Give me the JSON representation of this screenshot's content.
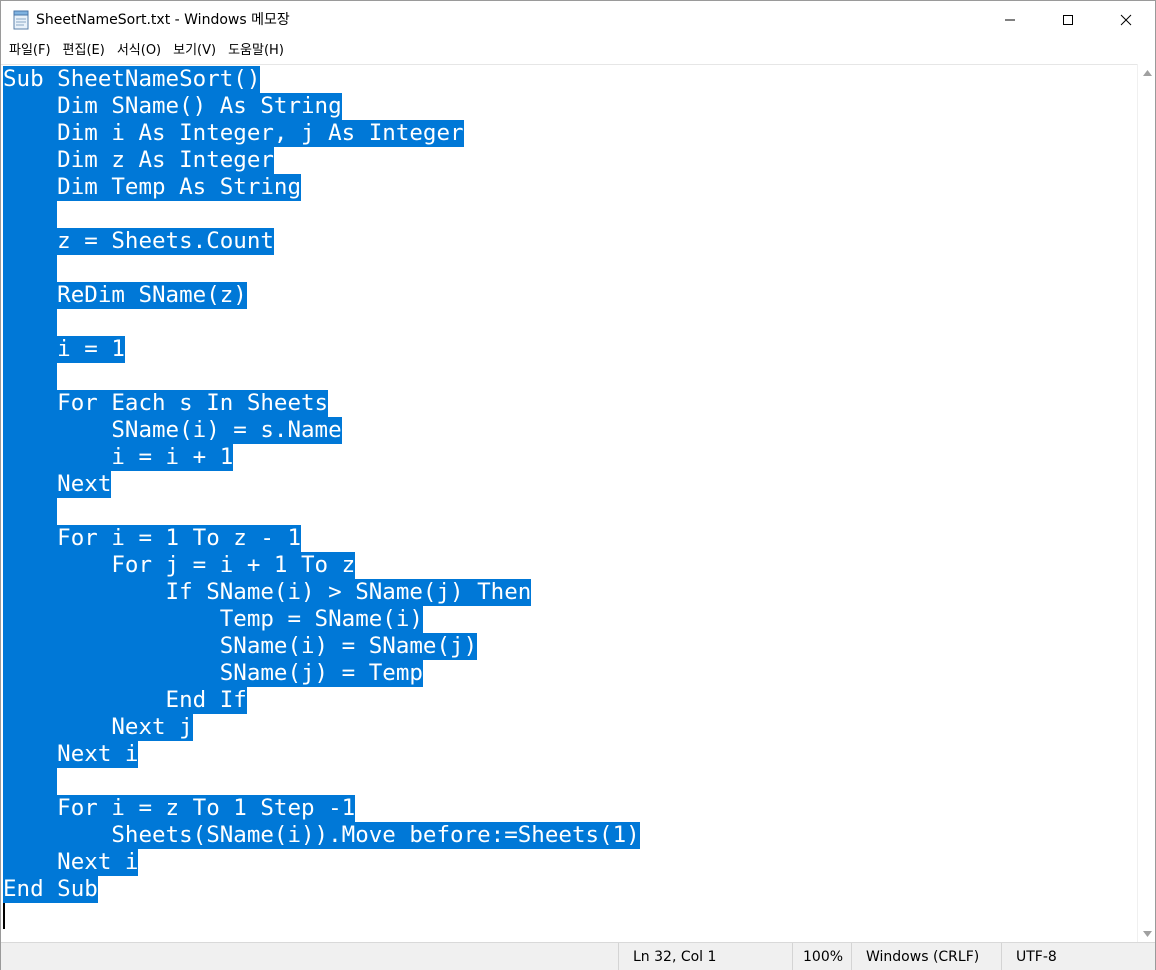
{
  "window": {
    "title": "SheetNameSort.txt - Windows 메모장"
  },
  "menu": [
    "파일(F)",
    "편집(E)",
    "서식(O)",
    "보기(V)",
    "도움말(H)"
  ],
  "editor": {
    "lines": [
      "Sub SheetNameSort()",
      "    Dim SName() As String",
      "    Dim i As Integer, j As Integer",
      "    Dim z As Integer",
      "    Dim Temp As String",
      "    ",
      "    z = Sheets.Count",
      "    ",
      "    ReDim SName(z)",
      "    ",
      "    i = 1",
      "    ",
      "    For Each s In Sheets",
      "        SName(i) = s.Name",
      "        i = i + 1",
      "    Next",
      "    ",
      "    For i = 1 To z - 1",
      "        For j = i + 1 To z",
      "            If SName(i) > SName(j) Then",
      "                Temp = SName(i)",
      "                SName(i) = SName(j)",
      "                SName(j) = Temp",
      "            End If",
      "        Next j",
      "    Next i",
      "    ",
      "    For i = z To 1 Step -1",
      "        Sheets(SName(i)).Move before:=Sheets(1)",
      "    Next i",
      "End Sub"
    ]
  },
  "status": {
    "position": "Ln 32, Col 1",
    "zoom": "100%",
    "line_ending": "Windows (CRLF)",
    "encoding": "UTF-8"
  },
  "colors": {
    "selection": "#0078d7",
    "selection_text": "#ffffff",
    "statusbar_bg": "#f0f0f0"
  },
  "icons": [
    "notepad-icon",
    "minimize-icon",
    "maximize-icon",
    "close-icon",
    "scroll-up-icon",
    "scroll-down-icon"
  ]
}
